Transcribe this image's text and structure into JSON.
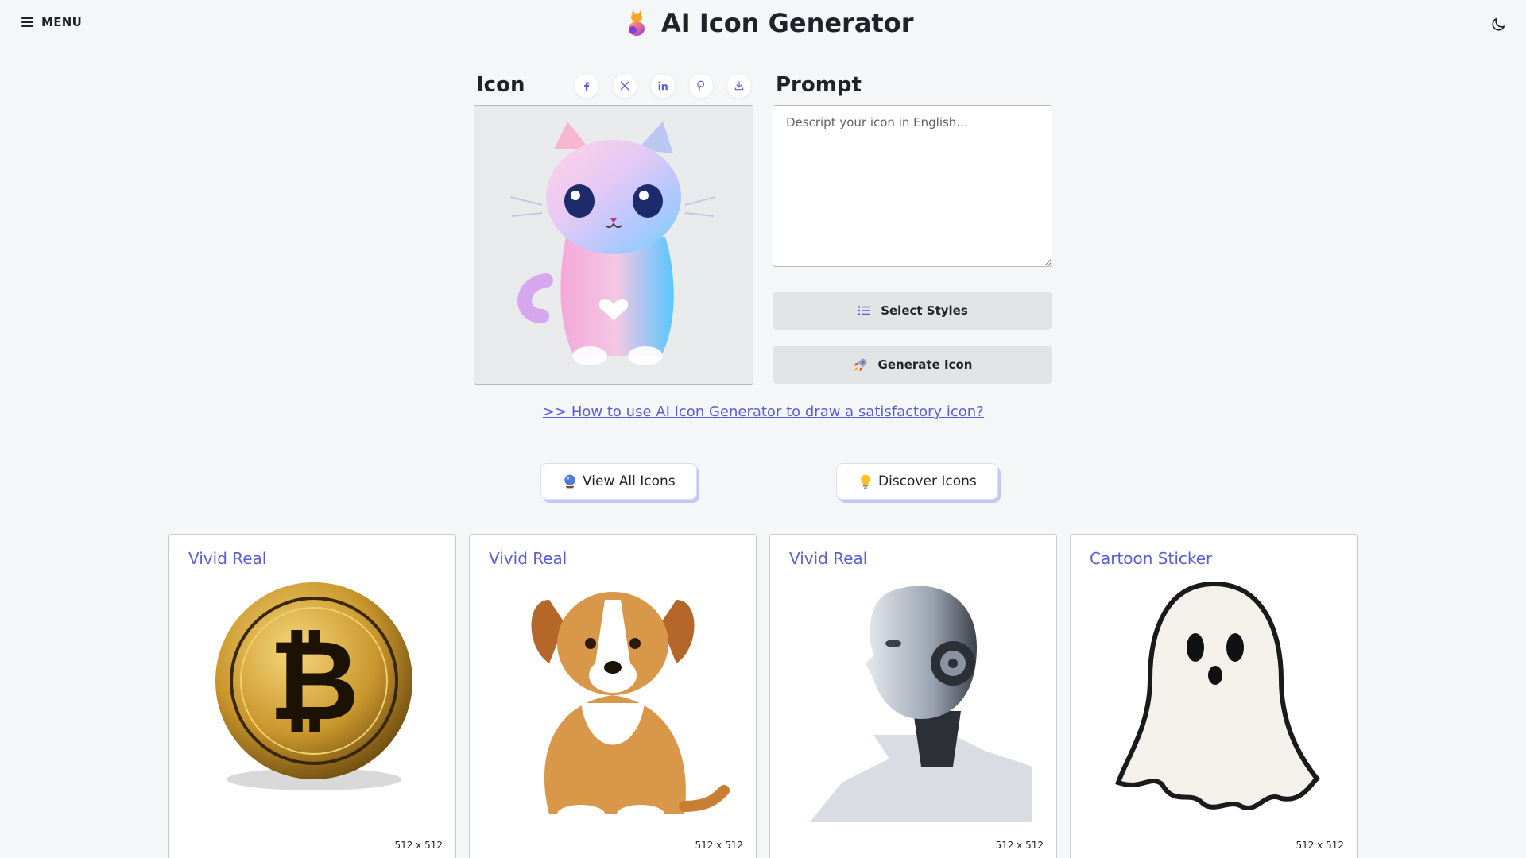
{
  "header": {
    "menu_label": "MENU",
    "title": "AI Icon Generator"
  },
  "generator": {
    "icon_title": "Icon",
    "prompt_title": "Prompt",
    "prompt_placeholder": "Descript your icon in English...",
    "prompt_value": "",
    "select_styles_label": "Select Styles",
    "generate_label": "Generate Icon",
    "help_link": ">> How to use AI Icon Generator to draw a satisfactory icon?",
    "share_icons": [
      "facebook-icon",
      "x-icon",
      "linkedin-icon",
      "pinterest-icon",
      "download-icon"
    ]
  },
  "nav_buttons": {
    "view_all": "View All Icons",
    "discover": "Discover Icons"
  },
  "gallery": [
    {
      "style": "Vivid Real",
      "size": "512 x 512",
      "icon": "bitcoin-coin-image"
    },
    {
      "style": "Vivid Real",
      "size": "512 x 512",
      "icon": "puppy-image"
    },
    {
      "style": "Vivid Real",
      "size": "512 x 512",
      "icon": "robot-head-image"
    },
    {
      "style": "Cartoon Sticker",
      "size": "512 x 512",
      "icon": "ghost-sticker-image"
    }
  ],
  "colors": {
    "accent": "#5a5ed6",
    "background": "#f5f6f7",
    "button": "#e2e3e5",
    "shadow": "#c5c8f7"
  }
}
